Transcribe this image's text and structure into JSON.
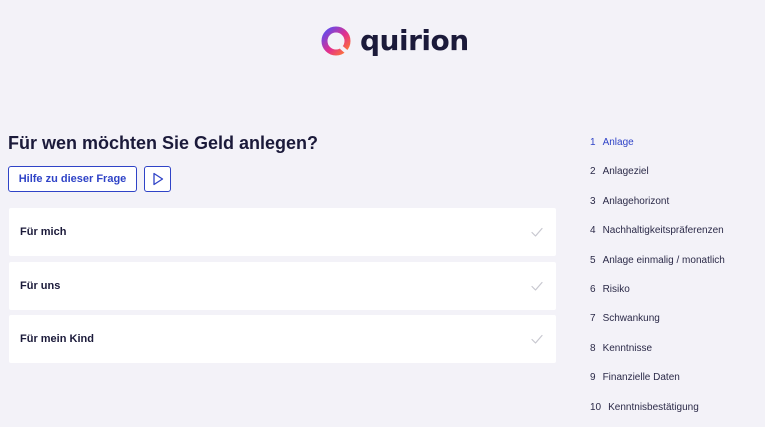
{
  "brand": {
    "name": "quirion",
    "colors": {
      "accent": "#2f43c7",
      "text": "#1b1a3a",
      "background": "#f3f2f8",
      "check": "#c8c8d0",
      "logo_gradient": [
        "#5a4df2",
        "#e22f8e",
        "#ff7a2f"
      ]
    }
  },
  "question": {
    "title": "Für wen möchten Sie Geld anlegen?",
    "help_label": "Hilfe zu dieser Frage",
    "play_icon": "play-icon"
  },
  "options": [
    {
      "label": "Für mich",
      "icon": "check-icon"
    },
    {
      "label": "Für uns",
      "icon": "check-icon"
    },
    {
      "label": "Für mein Kind",
      "icon": "check-icon"
    }
  ],
  "steps": [
    {
      "number": "1",
      "label": "Anlage",
      "active": true
    },
    {
      "number": "2",
      "label": "Anlageziel",
      "active": false
    },
    {
      "number": "3",
      "label": "Anlagehorizont",
      "active": false
    },
    {
      "number": "4",
      "label": "Nachhaltigkeitspräferenzen",
      "active": false
    },
    {
      "number": "5",
      "label": "Anlage einmalig / monatlich",
      "active": false
    },
    {
      "number": "6",
      "label": "Risiko",
      "active": false
    },
    {
      "number": "7",
      "label": "Schwankung",
      "active": false
    },
    {
      "number": "8",
      "label": "Kenntnisse",
      "active": false
    },
    {
      "number": "9",
      "label": "Finanzielle Daten",
      "active": false
    },
    {
      "number": "10",
      "label": "Kenntnisbestätigung",
      "active": false
    }
  ]
}
